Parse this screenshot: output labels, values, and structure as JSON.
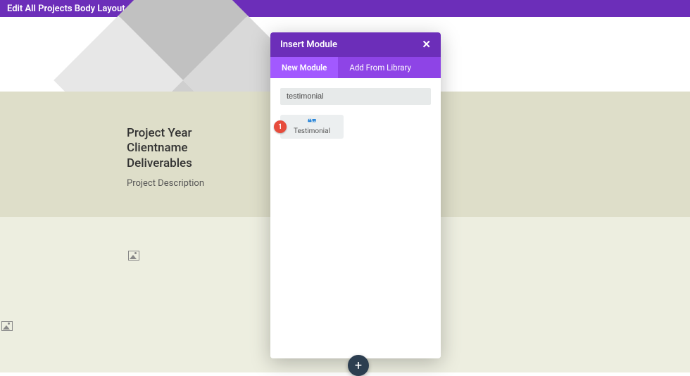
{
  "topbar": {
    "title": "Edit All Projects Body Layout"
  },
  "project": {
    "line1": "Project Year",
    "line2": "Clientname",
    "line3": "Deliverables",
    "desc": "Project Description"
  },
  "modal": {
    "title": "Insert Module",
    "close_glyph": "✕",
    "tabs": {
      "new": "New Module",
      "library": "Add From Library"
    },
    "search_value": "testimonial",
    "module": {
      "badge": "1",
      "icon_glyph": "❝❞",
      "label": "Testimonial"
    }
  },
  "fab": {
    "glyph": "+"
  }
}
